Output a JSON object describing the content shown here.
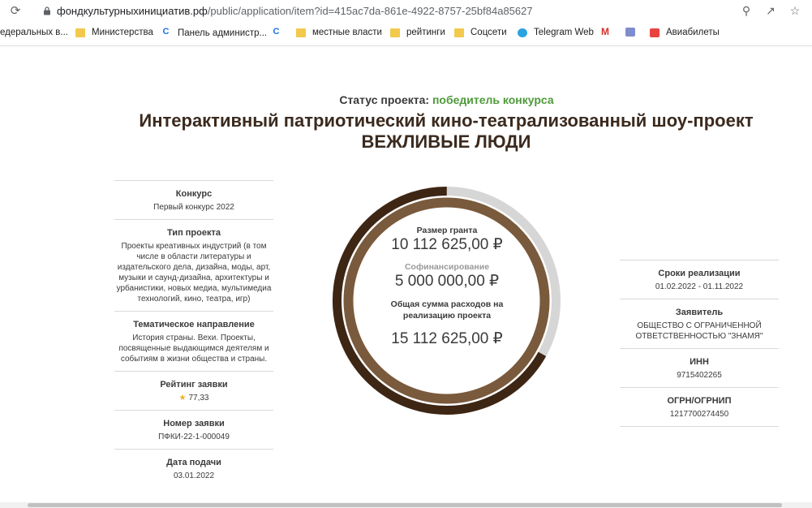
{
  "browser": {
    "url_host": "фондкультурныхинициатив.рф",
    "url_path": "/public/application/item?id=415ac7da-861e-4922-8757-25bf84a85627",
    "bookmarks": [
      {
        "label": "едеральных в..."
      },
      {
        "label": "Министерства"
      },
      {
        "label": "Панель администр..."
      },
      {
        "label": ""
      },
      {
        "label": "местные власти"
      },
      {
        "label": "рейтинги"
      },
      {
        "label": "Соцсети"
      },
      {
        "label": "Telegram Web"
      },
      {
        "label": ""
      },
      {
        "label": ""
      },
      {
        "label": "Авиабилеты"
      }
    ]
  },
  "project": {
    "status_label": "Статус проекта:",
    "status_value": "победитель конкурса",
    "title_line1": "Интерактивный патриотический кино-театрализованный шоу-проект",
    "title_line2": "ВЕЖЛИВЫЕ ЛЮДИ"
  },
  "left": [
    {
      "label": "Конкурс",
      "value": "Первый конкурс 2022"
    },
    {
      "label": "Тип проекта",
      "value": "Проекты креативных индустрий (в том числе в области литературы и издательского дела, дизайна, моды, арт, музыки и саунд-дизайна, архитектуры и урбанистики, новых медиа, мультимедиа технологий, кино, театра, игр)"
    },
    {
      "label": "Тематическое направление",
      "value": "История страны. Вехи. Проекты, посвященные выдающимся деятелям и событиям в жизни общества и страны."
    },
    {
      "label": "Рейтинг заявки",
      "value": "77,33"
    },
    {
      "label": "Номер заявки",
      "value": "ПФКИ-22-1-000049"
    },
    {
      "label": "Дата подачи",
      "value": "03.01.2022"
    }
  ],
  "finance": {
    "grant_label": "Размер гранта",
    "grant_value": "10 112 625,00 ₽",
    "cofin_label": "Софинансирование",
    "cofin_value": "5 000 000,00 ₽",
    "total_label": "Общая сумма расходов на реализацию проекта",
    "total_value": "15 112 625,00 ₽",
    "grant_share": 0.669
  },
  "right": [
    {
      "label": "Сроки реализации",
      "value": "01.02.2022 - 01.11.2022"
    },
    {
      "label": "Заявитель",
      "value": "ОБЩЕСТВО С ОГРАНИЧЕННОЙ ОТВЕТСТВЕННОСТЬЮ \"ЗНАМЯ\""
    },
    {
      "label": "ИНН",
      "value": "9715402265"
    },
    {
      "label": "ОГРН/ОГРНИП",
      "value": "1217700274450"
    }
  ],
  "colors": {
    "ring_dark": "#3e2614",
    "ring_inner": "#7a5a3c",
    "ring_grey": "#d6d6d6",
    "status_green": "#4e9a3a"
  }
}
